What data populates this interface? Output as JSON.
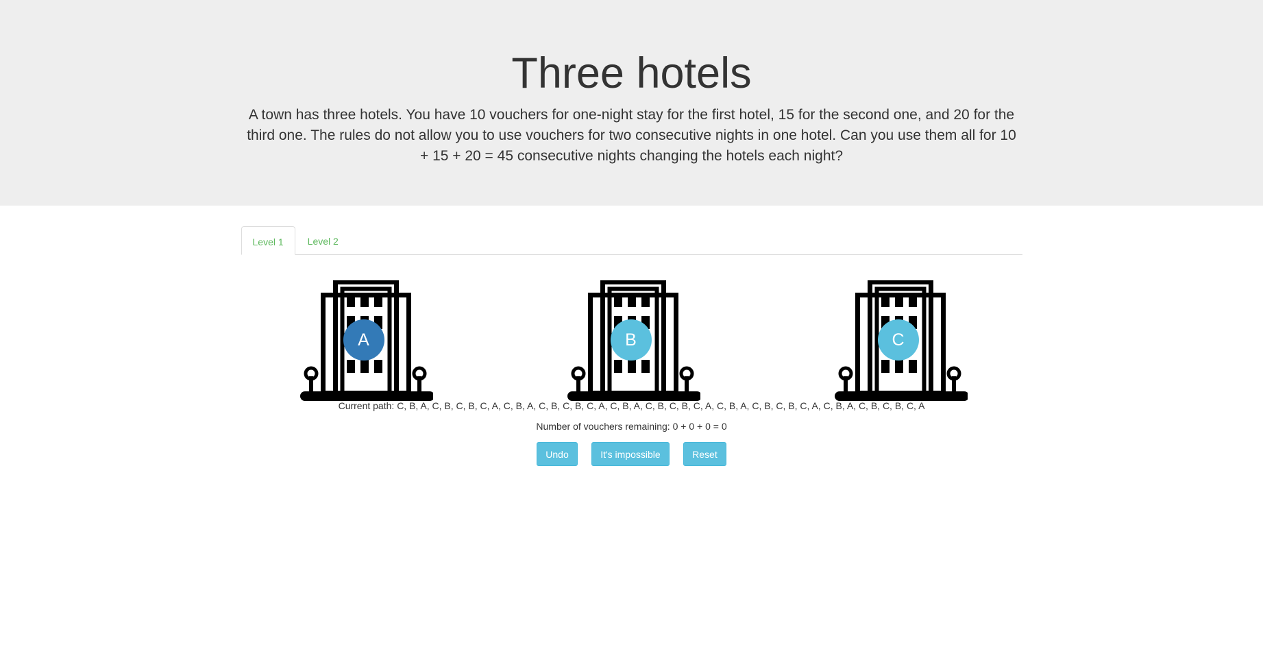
{
  "header": {
    "title": "Three hotels",
    "description": "A town has three hotels. You have 10 vouchers for one-night stay for the first hotel, 15 for the second one, and 20 for the third one. The rules do not allow you to use vouchers for two consecutive nights in one hotel. Can you use them all for 10 + 15 + 20 = 45 consecutive nights changing the hotels each night?"
  },
  "tabs": [
    {
      "label": "Level 1",
      "active": true
    },
    {
      "label": "Level 2",
      "active": false
    }
  ],
  "hotels": [
    {
      "label": "A",
      "color": "#337ab7",
      "icon": "hotel-building-icon"
    },
    {
      "label": "B",
      "color": "#5bc0de",
      "icon": "hotel-building-icon"
    },
    {
      "label": "C",
      "color": "#5bc0de",
      "icon": "hotel-building-icon"
    }
  ],
  "status": {
    "path_label": "Current path:",
    "path_value": "C, B, A, C, B, C, B, C, A, C, B, A, C, B, C, B, C, A, C, B, A, C, B, C, B, C, A, C, B, A, C, B, C, B, C, A, C, B, A, C, B, C, B, C, A",
    "remaining_label": "Number of vouchers remaining:",
    "remaining_value": "0 + 0 + 0 = 0"
  },
  "buttons": {
    "undo": "Undo",
    "impossible": "It's impossible",
    "reset": "Reset"
  },
  "colors": {
    "tab_text": "#5cb85c",
    "button_bg": "#5bc0de",
    "selected_hotel": "#337ab7"
  }
}
